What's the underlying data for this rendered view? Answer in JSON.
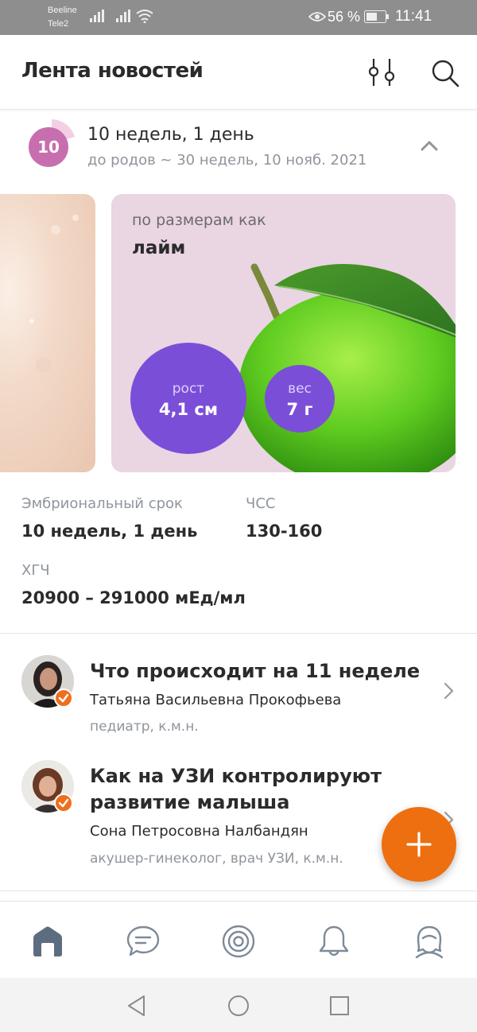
{
  "status_bar": {
    "carrier1": "Beeline",
    "carrier2": "Tele2",
    "battery": "56 %",
    "time": "11:41"
  },
  "header": {
    "title": "Лента новостей"
  },
  "week": {
    "number": "10",
    "title": "10 недель, 1 день",
    "subtitle": "до родов ~ 30 недель, 10 нояб. 2021"
  },
  "size_card": {
    "prefix": "по размерам как",
    "fruit": "лайм",
    "height_label": "рост",
    "height_value": "4,1 см",
    "weight_label": "вес",
    "weight_value": "7 г"
  },
  "info": {
    "embryo_label": "Эмбриональный срок",
    "embryo_value": "10 недель, 1 день",
    "hr_label": "ЧСС",
    "hr_value": "130-160",
    "hcg_label": "ХГЧ",
    "hcg_value": "20900 – 291000 мЕд/мл"
  },
  "articles": [
    {
      "title": "Что происходит на 11 неделе",
      "author": "Татьяна Васильевна Прокофьева",
      "role": "педиатр, к.м.н."
    },
    {
      "title": "Как на УЗИ контролируют развитие малыша",
      "author": "Сона Петросовна Налбандян",
      "role": "акушер-гинеколог, врач УЗИ, к.м.н."
    }
  ],
  "colors": {
    "accent": "#ee6f0f",
    "purple": "#7b4ed8",
    "week_badge": "#c76fae",
    "card_bg": "#ead5e3"
  }
}
